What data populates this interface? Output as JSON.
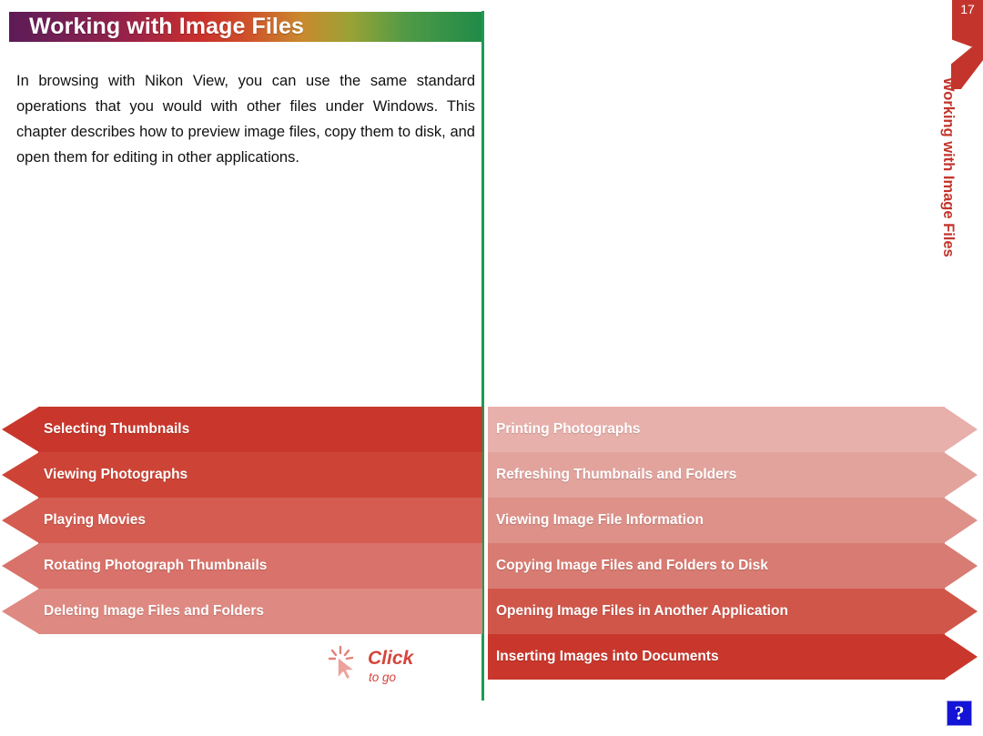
{
  "page": {
    "number": "17",
    "chapter_title": "Working with Image Files",
    "side_tab_text": "Working with Image Files"
  },
  "banner": {
    "title": "Working with Image Files",
    "gradient_stops": [
      "#5d1a56",
      "#9b2248",
      "#c9302c",
      "#cf4f2a",
      "#c98a2e",
      "#4f9a46",
      "#1f8b48"
    ]
  },
  "intro": {
    "paragraph": "In browsing with Nikon View, you can use the same standard operations that you would with other files under Windows. This chapter describes how to preview image files, copy them to disk, and open them for editing in other applications."
  },
  "divider": {
    "color": "#1f9a52"
  },
  "left_column": {
    "items": [
      {
        "label": "Selecting Thumbnails",
        "color": "#c9372c"
      },
      {
        "label": "Viewing Photographs",
        "color": "#cd4436"
      },
      {
        "label": "Playing Movies",
        "color": "#d45c50"
      },
      {
        "label": "Rotating Photograph Thumbnails",
        "color": "#d9726a"
      },
      {
        "label": "Deleting Image Files and Folders",
        "color": "#de8981"
      }
    ]
  },
  "right_column": {
    "items": [
      {
        "label": "Printing Photographs",
        "color": "#e8b0ab"
      },
      {
        "label": "Refreshing Thumbnails and Folders",
        "color": "#e2a39d"
      },
      {
        "label": "Viewing Image File Information",
        "color": "#dd9189"
      },
      {
        "label": "Copying Image Files and Folders to Disk",
        "color": "#d87b72"
      },
      {
        "label": "Opening Image Files in Another Application",
        "color": "#d0564a"
      },
      {
        "label": "Inserting Images into Documents",
        "color": "#c9372c"
      }
    ]
  },
  "click_hint": {
    "primary": "Click",
    "secondary": "to go",
    "color": "#d4463d",
    "icon": "cursor-sparkle-icon"
  },
  "help": {
    "glyph": "?",
    "background": "#1414d6",
    "icon": "question-mark-icon"
  }
}
